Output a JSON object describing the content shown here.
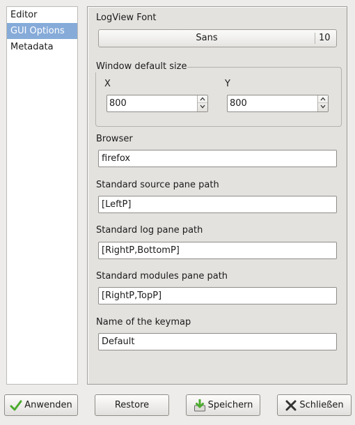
{
  "sidebar": {
    "items": [
      {
        "label": "Editor"
      },
      {
        "label": "GUI Options"
      },
      {
        "label": "Metadata"
      }
    ],
    "selected": "GUI Options"
  },
  "panel": {
    "font_label": "LogView Font",
    "font_name": "Sans",
    "font_size": "10",
    "window_frame_title": "Window default size",
    "x_label": "X",
    "y_label": "Y",
    "x_value": "800",
    "y_value": "800",
    "browser_label": "Browser",
    "browser_value": "firefox",
    "source_pane_label": "Standard source pane path",
    "source_pane_value": "[LeftP]",
    "log_pane_label": "Standard log pane path",
    "log_pane_value": "[RightP,BottomP]",
    "modules_pane_label": "Standard modules pane path",
    "modules_pane_value": "[RightP,TopP]",
    "keymap_label": "Name of the keymap",
    "keymap_value": "Default"
  },
  "buttons": {
    "apply": "Anwenden",
    "restore": "Restore",
    "save": "Speichern",
    "close": "Schließen"
  },
  "colors": {
    "selection": "#86abd9",
    "background": "#edeceb",
    "panel": "#e4e2df",
    "apply_icon": "#4caa2d",
    "save_icon": "#4caa2d",
    "close_icon": "#333333"
  }
}
